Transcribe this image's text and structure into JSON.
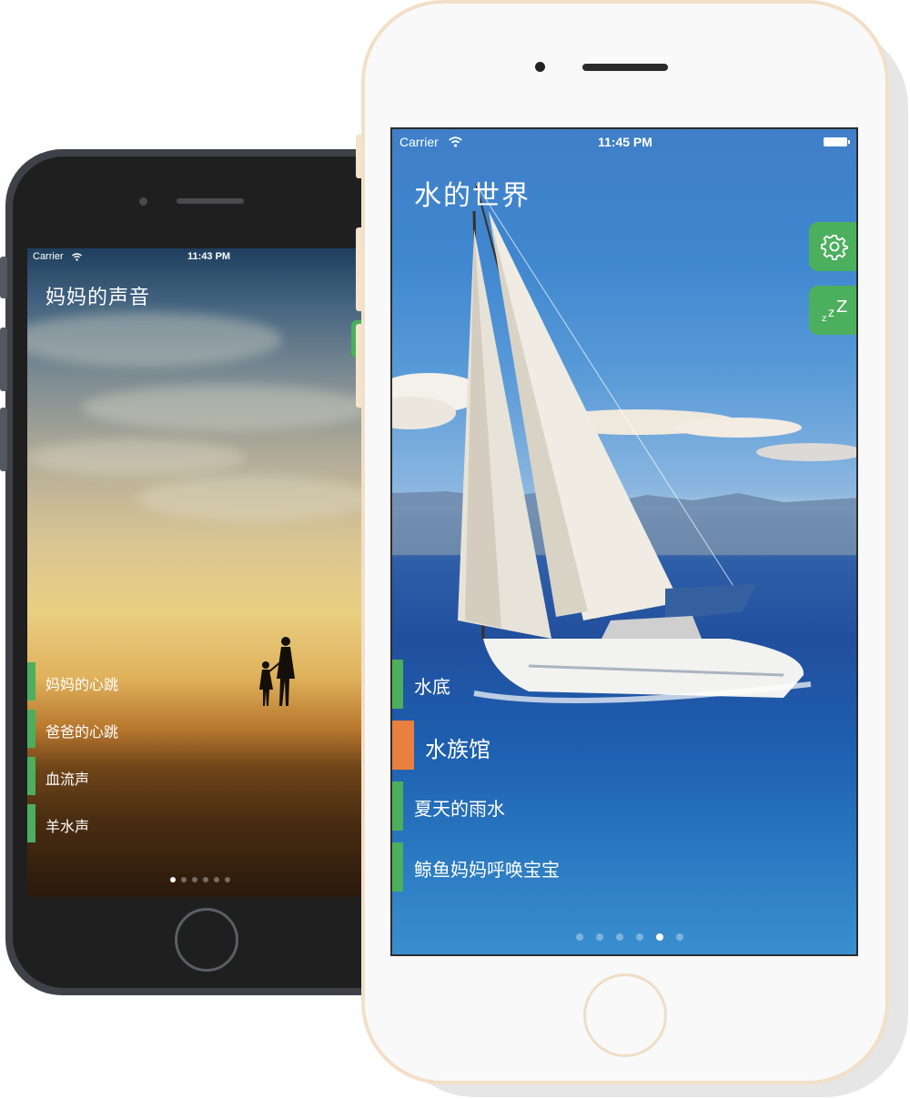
{
  "phone_back": {
    "status": {
      "carrier": "Carrier",
      "time": "11:43 PM"
    },
    "title": "妈妈的声音",
    "items": [
      {
        "label": "妈妈的心跳"
      },
      {
        "label": "爸爸的心跳"
      },
      {
        "label": "血流声"
      },
      {
        "label": "羊水声"
      }
    ],
    "page_count": 6,
    "page_active": 1
  },
  "phone_front": {
    "status": {
      "carrier": "Carrier",
      "time": "11:45 PM"
    },
    "title": "水的世界",
    "side_buttons": [
      {
        "icon": "gear-icon"
      },
      {
        "icon": "sleep-zzz-icon"
      }
    ],
    "items": [
      {
        "label": "水底",
        "selected": false
      },
      {
        "label": "水族馆",
        "selected": true
      },
      {
        "label": "夏天的雨水",
        "selected": false
      },
      {
        "label": "鲸鱼妈妈呼唤宝宝",
        "selected": false
      }
    ],
    "page_count": 6,
    "page_active": 5
  },
  "colors": {
    "accent_green": "#4caf5d",
    "selected_orange": "#e9803f",
    "white_phone_trim": "#f2dfc8",
    "dark_phone_body": "#3e4248"
  }
}
